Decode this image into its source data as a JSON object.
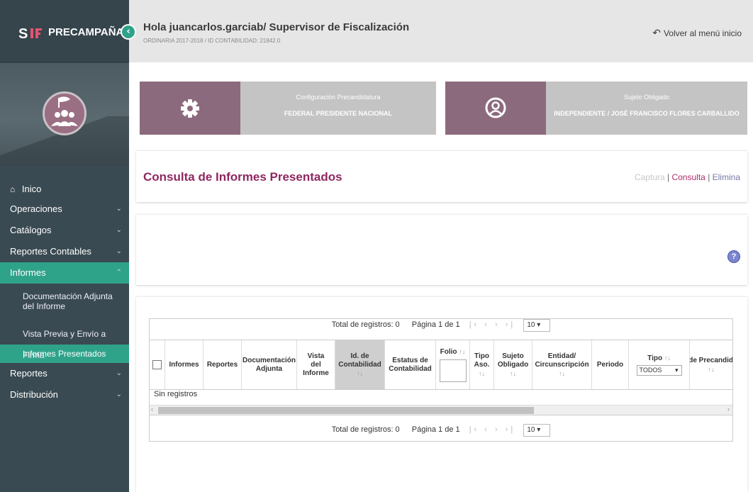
{
  "brand": {
    "title": "PRECAMPAÑA",
    "logo_text": "SIF"
  },
  "header": {
    "greeting": "Hola juancarlos.garciab/ Supervisor de Fiscalización",
    "subline": "ORDINARIA 2017-2018 / ID CONTABILIDAD: 21842.0",
    "back_label": "Volver al menú inicio"
  },
  "sidebar": {
    "home": "Inico",
    "items": [
      {
        "label": "Operaciones"
      },
      {
        "label": "Catálogos"
      },
      {
        "label": "Reportes Contables"
      },
      {
        "label": "Informes"
      }
    ],
    "informes_sub": [
      "Documentación Adjunta del Informe",
      "Vista Previa y Envío a Firma",
      "Informes Presentados"
    ],
    "after": [
      {
        "label": "Reportes"
      },
      {
        "label": "Distribución"
      }
    ]
  },
  "cards": [
    {
      "title": "Configuración Precandidatura",
      "value": "FEDERAL PRESIDENTE NACIONAL",
      "icon": "gear-icon"
    },
    {
      "title": "Sujeto Obligado",
      "value": "INDEPENDIENTE / JOSÉ FRANCISCO FLORES CARBALLIDO",
      "icon": "user-icon"
    }
  ],
  "page": {
    "title": "Consulta de Informes Presentados",
    "actions": {
      "captura": "Captura",
      "consulta": "Consulta",
      "elimina": "Elimina"
    }
  },
  "table": {
    "total_label": "Total de registros: 0",
    "page_label": "Página 1 de 1",
    "page_size": "10",
    "columns": [
      "Informes",
      "Reportes",
      "Documentación Adjunta",
      "Vista del Informe",
      "Id. de Contabilidad",
      "Estatus de Contabilidad",
      "Folio",
      "Tipo Aso.",
      "Sujeto Obligado",
      "Entidad/ Circunscripción",
      "Periodo",
      "Tipo",
      "Tipo de Precandidatura"
    ],
    "tipo_filter": "TODOS",
    "empty": "Sin registros"
  },
  "colors": {
    "sidebar": "#3a4a52",
    "accent": "#2fa38a",
    "title": "#8f2861",
    "card_icon": "#8c6a7d"
  }
}
